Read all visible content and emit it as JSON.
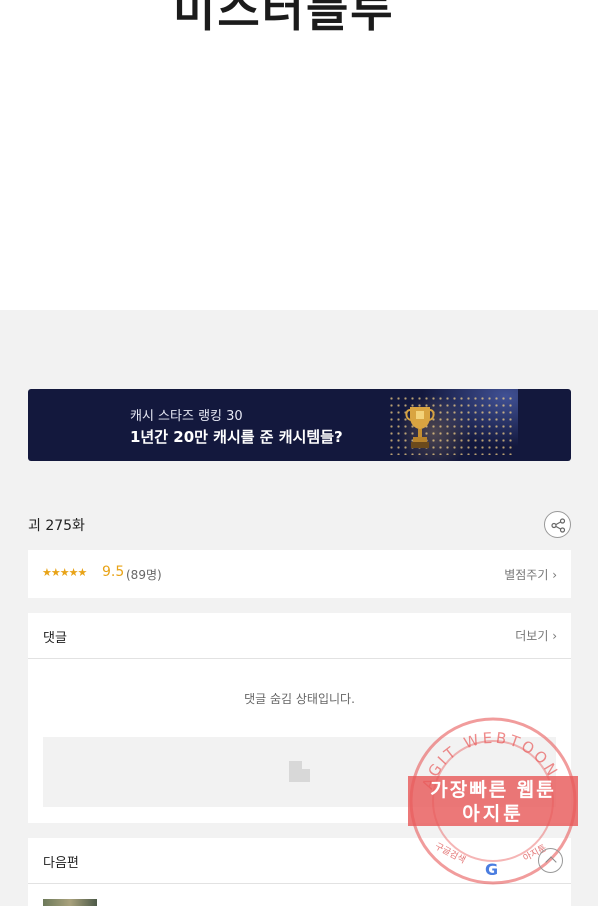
{
  "comic": {
    "title_partial": "미스터블루"
  },
  "banner": {
    "line1": "캐시 스타즈 랭킹 30",
    "line2": "1년간 20만 캐시를 준 캐시템들?"
  },
  "episode": {
    "title": "괴 275화"
  },
  "rating": {
    "stars": "★★★★★",
    "score": "9.5",
    "count": "(89명)",
    "rate_label": "별점주기 ›"
  },
  "comments": {
    "title": "댓글",
    "more_label": "더보기 ›",
    "hidden_message": "댓글 숨김 상태입니다."
  },
  "next_episode": {
    "title": "다음편"
  },
  "watermark": {
    "ring_text": "AGIT WEBTOON",
    "line1": "가장빠른 웹툰",
    "line2": "아지툰",
    "small_left": "구글검색",
    "small_right": "아지툰",
    "g_letter": "G"
  },
  "colors": {
    "banner_bg": "#13183d",
    "star": "#e8a317",
    "watermark": "#e85a5a"
  }
}
